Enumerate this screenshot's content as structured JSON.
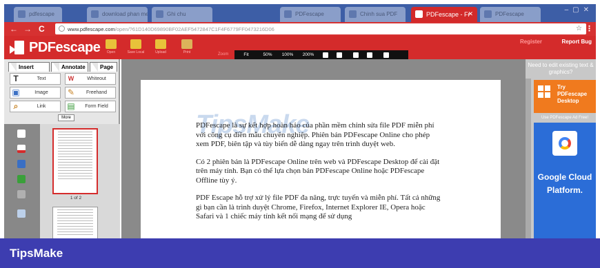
{
  "browser": {
    "tabs": [
      {
        "label": "pdfescape"
      },
      {
        "label": "download phan mem"
      },
      {
        "label": "Ghi chu"
      },
      {
        "label": "PDFescape"
      },
      {
        "label": "Chinh sua PDF"
      },
      {
        "label": "PDFescape - Fr",
        "active": true
      },
      {
        "label": "PDFescape"
      }
    ],
    "address": {
      "host": "www.pdfescape.com",
      "path": "/open/?61D140D69890BF02AEF5472847C1F4F6779FF0473216D06"
    }
  },
  "app": {
    "logo_text": "PDFescape",
    "toolbar": [
      {
        "icon": "folder-open-icon",
        "color": "#e8c23a",
        "label": "Open"
      },
      {
        "icon": "folder-save-icon",
        "color": "#e8c23a",
        "label": "Save Local"
      },
      {
        "icon": "folder-upload-icon",
        "color": "#e8c23a",
        "label": "Upload"
      },
      {
        "icon": "print-icon",
        "color": "#dcb35a",
        "label": "Print"
      }
    ],
    "zoom": {
      "label": "Zoom",
      "options": [
        "Fit",
        "50%",
        "100%",
        "200%"
      ]
    },
    "register_label": "Register",
    "report_bug_label": "Report Bug"
  },
  "left_panel": {
    "tabs": [
      "Insert",
      "Annotate",
      "Page"
    ],
    "tools": [
      {
        "glyph": "T",
        "label": "Text",
        "icon": "text-tool-icon"
      },
      {
        "glyph": "W",
        "label": "Whiteout",
        "icon": "whiteout-icon"
      },
      {
        "glyph": "▣",
        "label": "Image",
        "icon": "image-tool-icon"
      },
      {
        "glyph": "✎",
        "label": "Freehand",
        "icon": "pencil-icon"
      },
      {
        "glyph": "⌕",
        "label": "Link",
        "icon": "link-tool-icon"
      },
      {
        "glyph": "▤",
        "label": "Form Field",
        "icon": "form-field-icon"
      }
    ],
    "more_label": "More",
    "page_indicator": "1 of 2"
  },
  "document": {
    "watermark": "TipsMake",
    "paragraphs": [
      "PDFescape là sự kết hợp hoàn hảo của phần mềm chỉnh sửa file PDF miễn phí với công cụ điền mẫu chuyên nghiệp. Phiên bản PDFescape Online cho phép xem PDF, biên tập và tùy biến dễ dàng ngay trên trình duyệt web.",
      "Có 2 phiên bản là PDFescape Online trên web và PDFescape Desktop để cài đặt trên máy tính. Bạn có thể lựa chọn bản PDFescape Online hoặc PDFescape Offline tùy ý.",
      "PDF Escape hỗ trợ xử lý file PDF đa năng, trực tuyến và miễn phí. Tất cả những gì bạn cần là trình duyệt Chrome, Firefox, Internet Explorer IE, Opera hoặc Safari và 1 chiếc máy tính kết nối mạng để sử dụng"
    ]
  },
  "right_panel": {
    "heading": "Need to edit existing text & graphics?",
    "try_ad": "Try PDFescape Desktop",
    "ad_free": "Use PDFescape Ad Free!",
    "cloud_ad": "Google Cloud Platform."
  },
  "banner": {
    "text": "TipsMake",
    "color": "#3d3db0"
  }
}
